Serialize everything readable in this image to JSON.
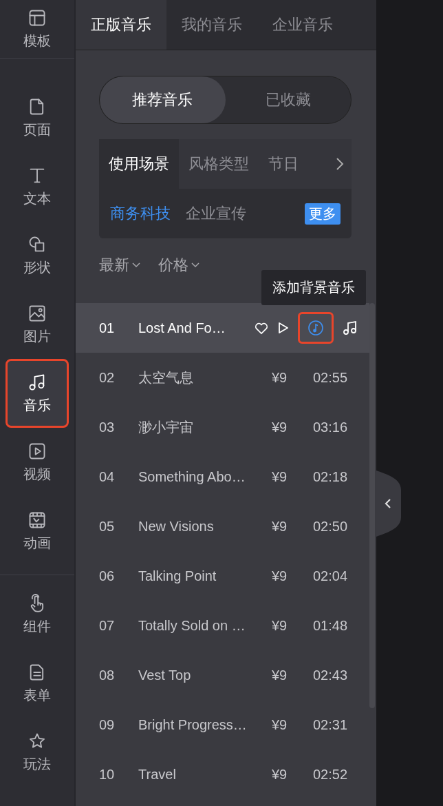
{
  "sidebar": {
    "groups": [
      {
        "items": [
          {
            "label": "模板",
            "selected": false,
            "highlighted": false
          }
        ]
      },
      {
        "items": [
          {
            "label": "页面",
            "selected": false,
            "highlighted": false
          },
          {
            "label": "文本",
            "selected": false,
            "highlighted": false
          },
          {
            "label": "形状",
            "selected": false,
            "highlighted": false
          },
          {
            "label": "图片",
            "selected": false,
            "highlighted": false
          },
          {
            "label": "音乐",
            "selected": true,
            "highlighted": true
          },
          {
            "label": "视频",
            "selected": false,
            "highlighted": false
          },
          {
            "label": "动画",
            "selected": false,
            "highlighted": false
          }
        ]
      },
      {
        "items": [
          {
            "label": "组件",
            "selected": false,
            "highlighted": false
          },
          {
            "label": "表单",
            "selected": false,
            "highlighted": false
          },
          {
            "label": "玩法",
            "selected": false,
            "highlighted": false
          }
        ]
      }
    ]
  },
  "tabs": [
    {
      "label": "正版音乐",
      "selected": true
    },
    {
      "label": "我的音乐",
      "selected": false
    },
    {
      "label": "企业音乐",
      "selected": false
    }
  ],
  "segments": [
    {
      "label": "推荐音乐",
      "selected": true
    },
    {
      "label": "已收藏",
      "selected": false
    }
  ],
  "categories": [
    {
      "label": "使用场景",
      "selected": true
    },
    {
      "label": "风格类型",
      "selected": false
    },
    {
      "label": "节日",
      "selected": false
    }
  ],
  "tags": [
    {
      "label": "商务科技",
      "selected": true
    },
    {
      "label": "企业宣传",
      "selected": false
    }
  ],
  "more_button": "更多",
  "sorts": [
    "最新",
    "价格"
  ],
  "tooltip": "添加背景音乐",
  "tracks": [
    {
      "kind": "hover",
      "number": "01",
      "title": "Lost And Fo…",
      "highlighted": true
    },
    {
      "kind": "plain",
      "number": "02",
      "title": "太空气息",
      "price": "¥9",
      "duration": "02:55"
    },
    {
      "kind": "plain",
      "number": "03",
      "title": "渺小宇宙",
      "price": "¥9",
      "duration": "03:16"
    },
    {
      "kind": "plain",
      "number": "04",
      "title": "Something Abo…",
      "price": "¥9",
      "duration": "02:18"
    },
    {
      "kind": "plain",
      "number": "05",
      "title": "New Visions",
      "price": "¥9",
      "duration": "02:50"
    },
    {
      "kind": "plain",
      "number": "06",
      "title": "Talking Point",
      "price": "¥9",
      "duration": "02:04"
    },
    {
      "kind": "plain",
      "number": "07",
      "title": "Totally Sold on …",
      "price": "¥9",
      "duration": "01:48"
    },
    {
      "kind": "plain",
      "number": "08",
      "title": "Vest Top",
      "price": "¥9",
      "duration": "02:43"
    },
    {
      "kind": "plain",
      "number": "09",
      "title": "Bright Progress…",
      "price": "¥9",
      "duration": "02:31"
    },
    {
      "kind": "plain",
      "number": "10",
      "title": "Travel",
      "price": "¥9",
      "duration": "02:52"
    }
  ]
}
